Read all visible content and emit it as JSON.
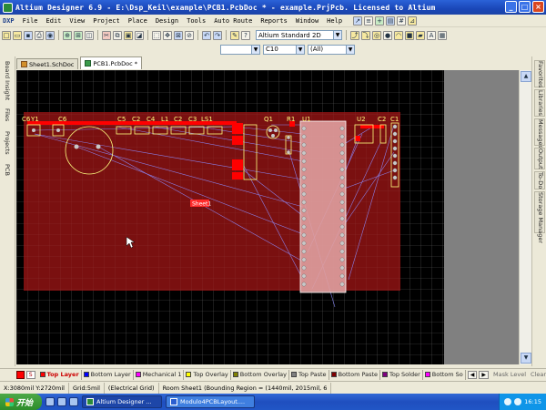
{
  "window": {
    "title": "Altium Designer 6.9 - E:\\Dsp_Keil\\example\\PCB1.PcbDoc * - example.PrjPcb. Licensed to Altium",
    "minimize": "_",
    "maximize": "□",
    "close": "×"
  },
  "menu": [
    "DXP",
    "File",
    "Edit",
    "View",
    "Project",
    "Place",
    "Design",
    "Tools",
    "Auto Route",
    "Reports",
    "Window",
    "Help"
  ],
  "toolbar2": {
    "layer_combo": "C10",
    "net_combo": "(All)",
    "view_combo": "Altium Standard 2D"
  },
  "doc_tabs": [
    {
      "label": "Sheet1.SchDoc",
      "active": false
    },
    {
      "label": "PCB1.PcbDoc *",
      "active": true
    }
  ],
  "left_panels": [
    "Board Insight",
    "Files",
    "Projects",
    "PCB"
  ],
  "right_panels": [
    "Favorites",
    "Libraries",
    "Messages",
    "Output",
    "To-Do",
    "Storage Manager"
  ],
  "canvas": {
    "room_label": "Sheet1",
    "component_labels": [
      {
        "text": "C6",
        "key": "c6"
      },
      {
        "text": "Y1",
        "key": "y1"
      },
      {
        "text": "C6",
        "key": "c6b"
      },
      {
        "text": "C5",
        "key": "c5"
      },
      {
        "text": "C2",
        "key": "c2"
      },
      {
        "text": "C4",
        "key": "c4"
      },
      {
        "text": "L1",
        "key": "l1"
      },
      {
        "text": "C2",
        "key": "c2b"
      },
      {
        "text": "C3",
        "key": "c3"
      },
      {
        "text": "LS1",
        "key": "ls1"
      },
      {
        "text": "Q1",
        "key": "q1"
      },
      {
        "text": "R1",
        "key": "r1"
      },
      {
        "text": "U1",
        "key": "u1"
      },
      {
        "text": "U2",
        "key": "u2"
      },
      {
        "text": "C2",
        "key": "c2c"
      },
      {
        "text": "C1",
        "key": "c1"
      }
    ]
  },
  "layers": [
    {
      "label": "Top Layer",
      "color": "#ff0000",
      "active": true
    },
    {
      "label": "Bottom Layer",
      "color": "#0000ff",
      "active": false
    },
    {
      "label": "Mechanical 1",
      "color": "#ff00ff",
      "active": false
    },
    {
      "label": "Top Overlay",
      "color": "#ffff00",
      "active": false
    },
    {
      "label": "Bottom Overlay",
      "color": "#808000",
      "active": false
    },
    {
      "label": "Top Paste",
      "color": "#808080",
      "active": false
    },
    {
      "label": "Bottom Paste",
      "color": "#800000",
      "active": false
    },
    {
      "label": "Top Solder",
      "color": "#800080",
      "active": false
    },
    {
      "label": "Bottom So",
      "color": "#ff00ff",
      "active": false
    }
  ],
  "layer_bar": {
    "s_label": "S",
    "mask_level": "Mask Level",
    "clear": "Clear"
  },
  "status": {
    "coords": "X:3080mil Y:2720mil",
    "grid": "Grid:5mil",
    "grid_type": "(Electrical Grid)",
    "room": "Room Sheet1 (Bounding Region = (1440mil, 2015mil, 6"
  },
  "taskbar": {
    "start": "开始",
    "tasks": [
      {
        "label": "Altium Designer ...",
        "active": true
      },
      {
        "label": "Modulo4PCBLayout....",
        "active": false
      }
    ],
    "clock": "16:15"
  },
  "colors": {
    "board": "#7a1010",
    "grid": "#5a5a5a",
    "top_layer": "#ff0000",
    "overlay": "#ffff80",
    "ratsnest": "#8c8cff"
  }
}
